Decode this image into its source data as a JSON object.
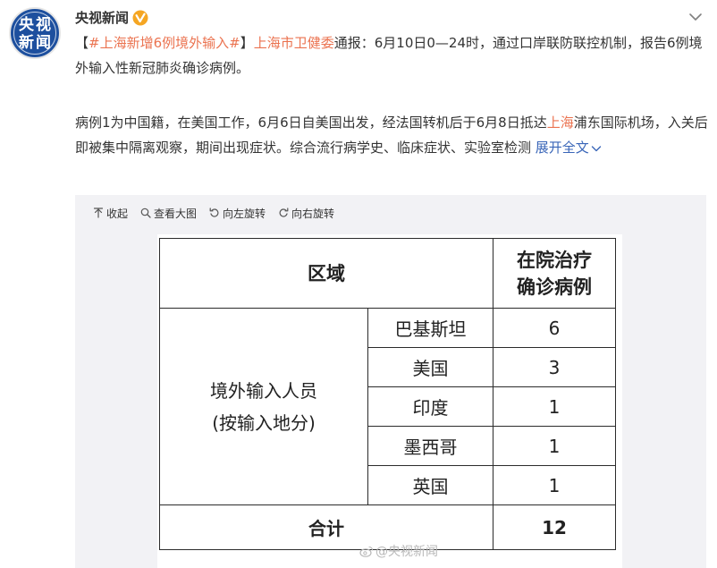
{
  "post": {
    "avatar_chars": [
      "央",
      "视",
      "新",
      "闻"
    ],
    "author_name": "央视新闻",
    "p1": {
      "open_bracket": "【",
      "hashtag": "#上海新增6例境外输入#",
      "close_bracket": "】",
      "mention": "上海市卫健委",
      "rest": "通报：6月10日0—24时，通过口岸联防联控机制，报告6例境外输入性新冠肺炎确诊病例。"
    },
    "p2": {
      "part1": "病例1为中国籍，在美国工作，6月6日自美国出发，经法国转机后于6月8日抵达",
      "place": "上海",
      "part2": "浦东国际机场，入关后即被集中隔离观察，期间出现症状。综合流行病学史、临床症状、实验室检测 ",
      "expand": "展开全文"
    }
  },
  "toolbar": {
    "collapse": "收起",
    "view_large": "查看大图",
    "rotate_left": "向左旋转",
    "rotate_right": "向右旋转"
  },
  "image_table": {
    "header": {
      "region": "区域",
      "count_line1": "在院治疗",
      "count_line2": "确诊病例"
    },
    "group_line1": "境外输入人员",
    "group_line2": "(按输入地分)",
    "rows": [
      {
        "country": "巴基斯坦",
        "count": "6"
      },
      {
        "country": "美国",
        "count": "3"
      },
      {
        "country": "印度",
        "count": "1"
      },
      {
        "country": "墨西哥",
        "count": "1"
      },
      {
        "country": "英国",
        "count": "1"
      }
    ],
    "total_label": "合计",
    "total_value": "12"
  },
  "watermark": "@央视新闻",
  "colors": {
    "hashtag": "#eb7350",
    "link": "#3a66b8",
    "avatar_bg": "#1d4f9e",
    "vip_badge": "#f5a623"
  }
}
